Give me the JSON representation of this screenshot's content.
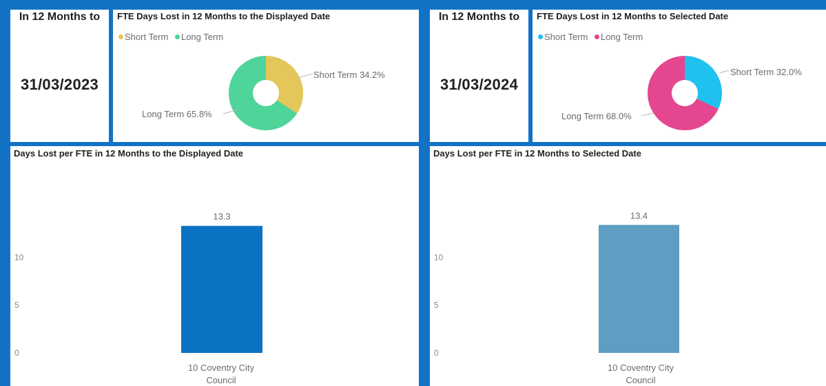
{
  "left": {
    "card": {
      "title": "In 12 Months to",
      "value": "31/03/2023"
    },
    "donut": {
      "title": "FTE Days Lost in 12 Months to the Displayed Date",
      "legend": [
        {
          "label": "Short Term",
          "color": "#e3c75a"
        },
        {
          "label": "Long Term",
          "color": "#4fd49a"
        }
      ],
      "labels": {
        "short": "Short Term 34.2%",
        "long": "Long Term 65.8%"
      }
    },
    "bar": {
      "title": "Days Lost per FTE in 12 Months to the Displayed Date",
      "category_line1": "10 Coventry City",
      "category_line2": "Council",
      "value_label": "13.3",
      "ticks": [
        "0",
        "5",
        "10"
      ]
    }
  },
  "right": {
    "card": {
      "title": "In 12 Months to",
      "value": "31/03/2024"
    },
    "donut": {
      "title": "FTE Days Lost in 12 Months to Selected Date",
      "legend": [
        {
          "label": "Short Term",
          "color": "#1fc1ef"
        },
        {
          "label": "Long Term",
          "color": "#e4468f"
        }
      ],
      "labels": {
        "short": "Short Term 32.0%",
        "long": "Long Term 68.0%"
      }
    },
    "bar": {
      "title": "Days Lost per FTE in 12 Months to Selected Date",
      "category_line1": "10 Coventry City",
      "category_line2": "Council",
      "value_label": "13.4",
      "ticks": [
        "0",
        "5",
        "10"
      ]
    }
  },
  "chart_data": [
    {
      "type": "pie",
      "title": "FTE Days Lost in 12 Months to the Displayed Date",
      "categories": [
        "Short Term",
        "Long Term"
      ],
      "values": [
        34.2,
        65.8
      ],
      "colors": [
        "#e3c75a",
        "#4fd49a"
      ],
      "legend": "top-left"
    },
    {
      "type": "bar",
      "title": "Days Lost per FTE in 12 Months to the Displayed Date",
      "categories": [
        "10 Coventry City Council"
      ],
      "values": [
        13.3
      ],
      "ylim": [
        0,
        14
      ],
      "yticks": [
        0,
        5,
        10
      ],
      "color": "#0a72c2",
      "grid": false
    },
    {
      "type": "pie",
      "title": "FTE Days Lost in 12 Months to Selected Date",
      "categories": [
        "Short Term",
        "Long Term"
      ],
      "values": [
        32.0,
        68.0
      ],
      "colors": [
        "#1fc1ef",
        "#e4468f"
      ],
      "legend": "top-left"
    },
    {
      "type": "bar",
      "title": "Days Lost per FTE in 12 Months to Selected Date",
      "categories": [
        "10 Coventry City Council"
      ],
      "values": [
        13.4
      ],
      "ylim": [
        0,
        14
      ],
      "yticks": [
        0,
        5,
        10
      ],
      "color": "#5e9ec2",
      "grid": false
    }
  ]
}
